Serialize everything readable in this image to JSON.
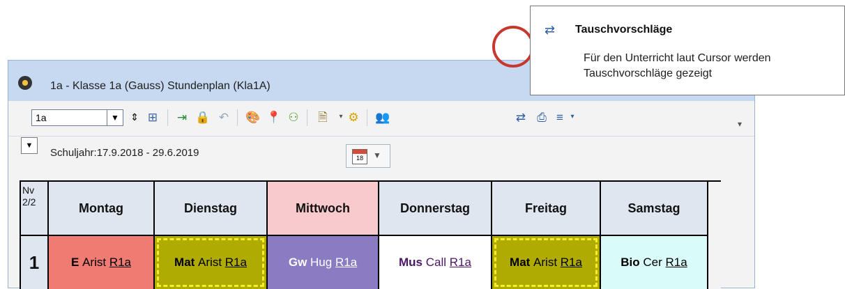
{
  "window": {
    "title": "1a - Klasse 1a (Gauss)  Stundenplan  (Kla1A)"
  },
  "toolbar": {
    "class_selector_value": "1a",
    "icons": [
      "spinner-updown-icon",
      "grid-icon",
      "import-icon",
      "lock-icon",
      "undo-icon",
      "palette-icon",
      "pin-icon",
      "people-icon",
      "document-icon",
      "gear-icon",
      "teachers-icon",
      "swap-suggestions-icon",
      "print-list-icon",
      "list-menu-icon"
    ]
  },
  "school_year": "Schuljahr:17.9.2018 - 29.6.2019",
  "calendar_day": "18",
  "timetable": {
    "corner": "Nv\n2/2",
    "days": [
      {
        "label": "Montag",
        "color": "#dfe6f0"
      },
      {
        "label": "Dienstag",
        "color": "#dfe6f0"
      },
      {
        "label": "Mittwoch",
        "color": "#f8c9cd"
      },
      {
        "label": "Donnerstag",
        "color": "#dfe6f0"
      },
      {
        "label": "Freitag",
        "color": "#dfe6f0"
      },
      {
        "label": "Samstag",
        "color": "#dfe6f0"
      }
    ],
    "period": "1",
    "lessons": [
      {
        "subject": "E",
        "teacher": "Arist",
        "room": "R1a",
        "bg": "#f07b73",
        "fg": "#000000",
        "selected": false
      },
      {
        "subject": "Mat",
        "teacher": "Arist",
        "room": "R1a",
        "bg": "#b0ab00",
        "fg": "#000000",
        "selected": true
      },
      {
        "subject": "Gw",
        "teacher": "Hug",
        "room": "R1a",
        "bg": "#8a7bc3",
        "fg": "#ffffff",
        "selected": false
      },
      {
        "subject": "Mus",
        "teacher": "Call",
        "room": "R1a",
        "bg": "#ffffff",
        "fg": "#4a1566",
        "selected": false
      },
      {
        "subject": "Mat",
        "teacher": "Arist",
        "room": "R1a",
        "bg": "#b0ab00",
        "fg": "#000000",
        "selected": true
      },
      {
        "subject": "Bio",
        "teacher": "Cer",
        "room": "R1a",
        "bg": "#d9fbf9",
        "fg": "#000000",
        "selected": false
      }
    ]
  },
  "tooltip": {
    "title": "Tauschvorschläge",
    "body": "Für den Unterricht laut Cursor werden Tauschvorschläge gezeigt"
  }
}
